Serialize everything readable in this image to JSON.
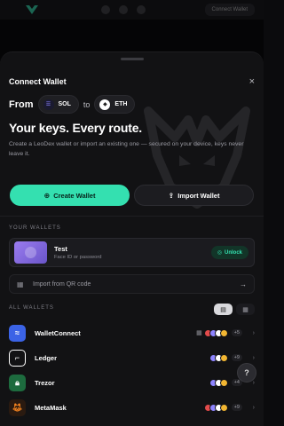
{
  "topbar": {
    "button_label": "Connect Wallet"
  },
  "modal": {
    "title": "Connect Wallet",
    "close_symbol": "×",
    "from_label": "From",
    "to_label": "to",
    "from_token": {
      "symbol": "SOL",
      "icon": "solana-icon"
    },
    "to_token": {
      "symbol": "ETH",
      "icon": "ethereum-icon"
    },
    "headline": "Your keys. Every route.",
    "description": "Create a LeoDex wallet or import an existing one — secured on your device, keys never leave it.",
    "create_button": "Create Wallet",
    "import_button": "Import Wallet",
    "accent_color": "#34e0b0"
  },
  "your_wallets": {
    "section_label": "YOUR WALLETS",
    "items": [
      {
        "name": "Test",
        "subtitle": "Face ID or password",
        "action": "Unlock"
      }
    ],
    "qr_label": "Import from QR code"
  },
  "all_wallets": {
    "section_label": "ALL WALLETS",
    "view_modes": [
      "list",
      "grid"
    ],
    "selected_view": "list",
    "items": [
      {
        "name": "WalletConnect",
        "more": "+5",
        "icon": "walletconnect-icon",
        "has_qr": true
      },
      {
        "name": "Ledger",
        "more": "+9",
        "icon": "ledger-icon",
        "has_qr": false
      },
      {
        "name": "Trezor",
        "more": "+4",
        "icon": "trezor-icon",
        "has_qr": false
      },
      {
        "name": "MetaMask",
        "more": "+9",
        "icon": "metamask-icon",
        "has_qr": false
      }
    ]
  },
  "help_label": "?"
}
